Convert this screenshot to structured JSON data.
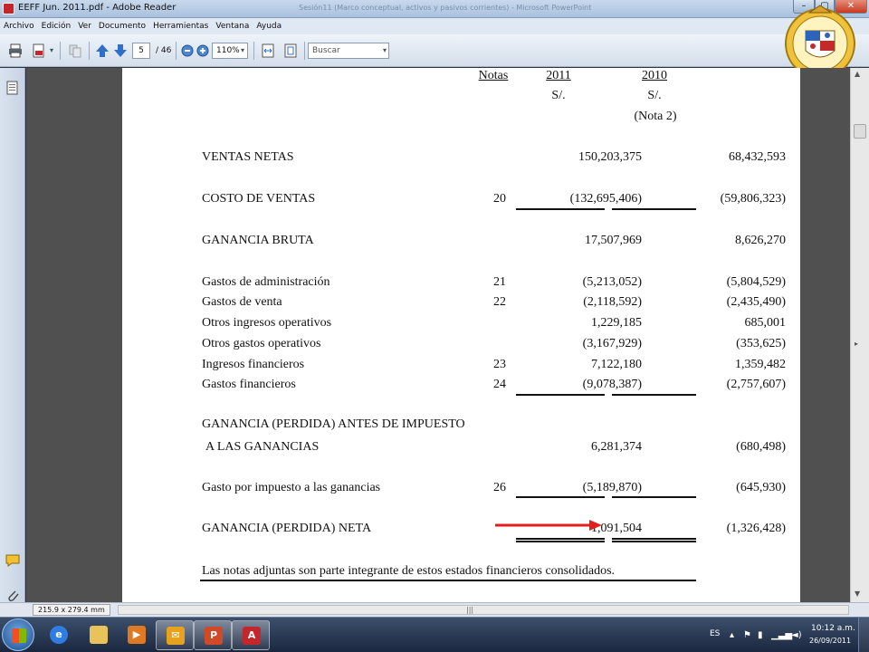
{
  "window": {
    "title": "EEFF Jun. 2011.pdf - Adobe Reader",
    "background_title": "Sesión11 (Marco conceptual, activos y pasivos corrientes) - Microsoft PowerPoint",
    "minimize": "–",
    "maximize": "▢",
    "close": "✕"
  },
  "menu": [
    "Archivo",
    "Edición",
    "Ver",
    "Documento",
    "Herramientas",
    "Ventana",
    "Ayuda"
  ],
  "toolbar": {
    "page_number": "5",
    "page_total": "/ 46",
    "zoom": "110%",
    "search_placeholder": "Buscar"
  },
  "statement": {
    "headers": {
      "notes": "Notas",
      "year1": "2011",
      "year2": "2010",
      "currency1": "S/.",
      "currency2": "S/.",
      "note2": "(Nota 2)"
    },
    "rows": [
      {
        "label": "VENTAS NETAS",
        "note": "",
        "y2011": "150,203,375",
        "y2010": "68,432,593"
      },
      {
        "label": "COSTO DE VENTAS",
        "note": "20",
        "y2011": "(132,695,406)",
        "y2010": "(59,806,323)"
      },
      {
        "label": "GANANCIA BRUTA",
        "note": "",
        "y2011": "17,507,969",
        "y2010": "8,626,270"
      },
      {
        "label": "Gastos de administración",
        "note": "21",
        "y2011": "(5,213,052)",
        "y2010": "(5,804,529)"
      },
      {
        "label": "Gastos de venta",
        "note": "22",
        "y2011": "(2,118,592)",
        "y2010": "(2,435,490)"
      },
      {
        "label": "Otros ingresos operativos",
        "note": "",
        "y2011": "1,229,185",
        "y2010": "685,001"
      },
      {
        "label": "Otros gastos operativos",
        "note": "",
        "y2011": "(3,167,929)",
        "y2010": "(353,625)"
      },
      {
        "label": "Ingresos financieros",
        "note": "23",
        "y2011": "7,122,180",
        "y2010": "1,359,482"
      },
      {
        "label": "Gastos financieros",
        "note": "24",
        "y2011": "(9,078,387)",
        "y2010": "(2,757,607)"
      },
      {
        "label": "GANANCIA (PERDIDA) ANTES DE IMPUESTO",
        "label2": "A LAS GANANCIAS",
        "note": "",
        "y2011": "6,281,374",
        "y2010": "(680,498)"
      },
      {
        "label": "Gasto por impuesto a las ganancias",
        "note": "26",
        "y2011": "(5,189,870)",
        "y2010": "(645,930)"
      },
      {
        "label": "GANANCIA (PERDIDA) NETA",
        "note": "",
        "y2011": "1,091,504",
        "y2010": "(1,326,428)"
      }
    ],
    "footnote": "Las notas adjuntas son parte integrante de estos estados financieros consolidados."
  },
  "status": {
    "page_size": "215.9 x 279.4 mm"
  },
  "taskbar": {
    "language": "ES",
    "time": "10:12 a.m.",
    "date": "26/09/2011"
  },
  "colors": {
    "arrow": "#e0201c",
    "taskbar": "#1b2740"
  }
}
